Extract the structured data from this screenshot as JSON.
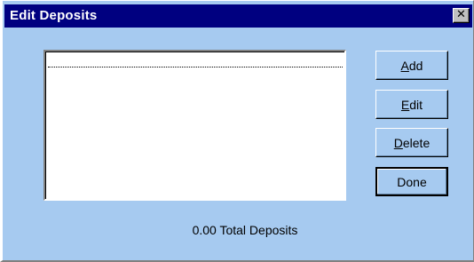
{
  "window": {
    "title": "Edit Deposits",
    "close_glyph": "✕",
    "background_color": "#a6caf0",
    "titlebar_color": "#000080"
  },
  "deposits_list": {
    "items": []
  },
  "buttons": {
    "add": {
      "mnemonic": "A",
      "rest": "dd"
    },
    "edit": {
      "mnemonic": "E",
      "rest": "dit"
    },
    "delete": {
      "mnemonic": "D",
      "rest": "elete"
    },
    "done": {
      "label": "Done"
    }
  },
  "summary": {
    "total_text": "0.00 Total Deposits"
  }
}
